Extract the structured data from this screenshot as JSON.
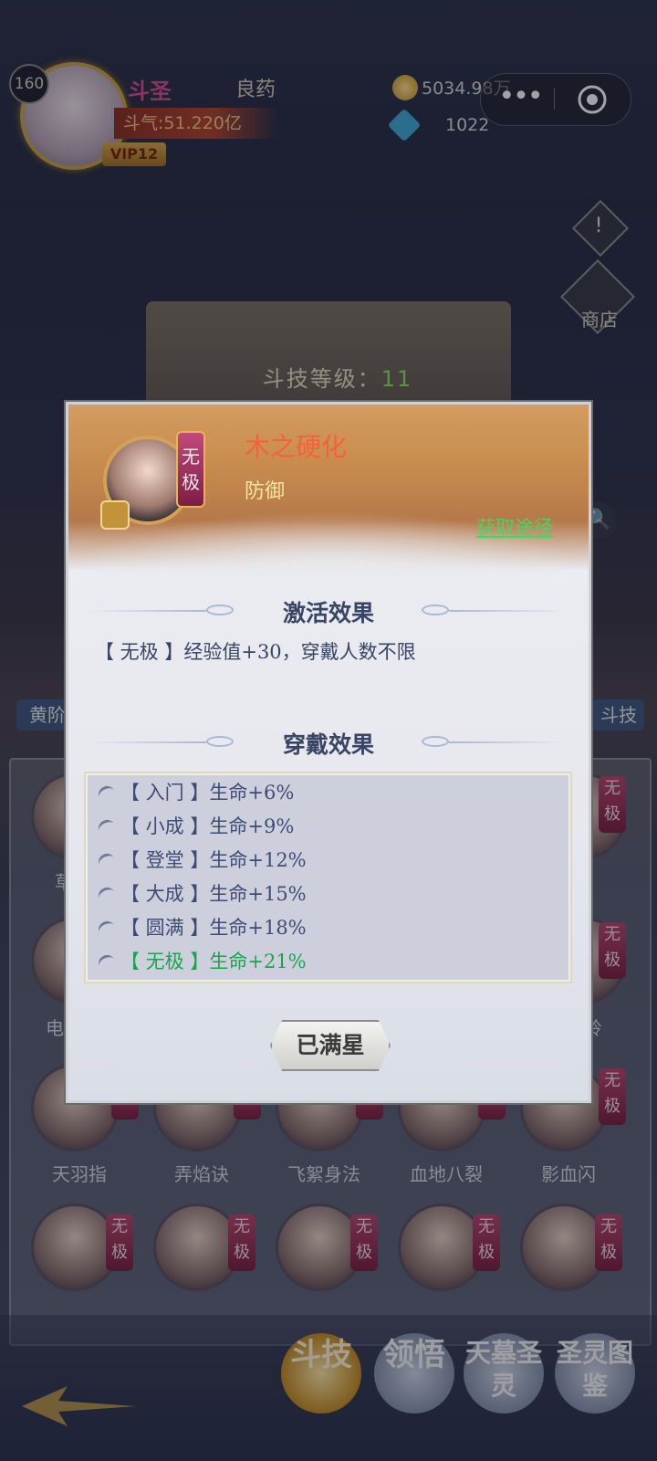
{
  "player": {
    "level": "160",
    "rank": "斗圣",
    "name": "良药",
    "power": "斗气:51.220亿",
    "vip": "VIP12"
  },
  "resources": {
    "gold": "5034.98万",
    "gems": "1022"
  },
  "side": {
    "alert": "!",
    "shop": "商店",
    "search": "🔍"
  },
  "background": {
    "level_label": "斗技等级：",
    "level_value": "11",
    "tab_left": "黄阶",
    "tab_right": "斗技"
  },
  "grid": {
    "row1": [
      {
        "name": "草",
        "tag": "无极"
      },
      {
        "name": "丧",
        "tag": "无极"
      }
    ],
    "row2": [
      {
        "name": "电",
        "tag": "无极"
      },
      {
        "name": "岭",
        "tag": "无极"
      }
    ],
    "row3": [
      {
        "name": "天羽指",
        "tag": "极"
      },
      {
        "name": "弄焰诀",
        "tag": "极"
      },
      {
        "name": "飞絮身法",
        "tag": "极"
      },
      {
        "name": "血地八裂",
        "tag": "极"
      },
      {
        "name": "影血闪",
        "tag": "无极"
      }
    ],
    "row4": [
      {
        "tag": "无极"
      },
      {
        "tag": "无极"
      },
      {
        "tag": "无极"
      },
      {
        "tag": "无极"
      },
      {
        "tag": "无极"
      }
    ]
  },
  "nav": {
    "douji": "斗技",
    "lingwu": "领悟",
    "tianmu": "天墓圣灵",
    "tujian": "圣灵图鉴"
  },
  "modal": {
    "hero_rank_tag": "无极",
    "skill_name": "木之硬化",
    "skill_type": "防御",
    "source_link": "获取途径",
    "activate_title": "激活效果",
    "activate_effect": "【 无极 】经验值+30，穿戴人数不限",
    "wear_title": "穿戴效果",
    "wear_effects": [
      {
        "tier": "【 入门 】",
        "effect": "生命+6%"
      },
      {
        "tier": "【 小成 】",
        "effect": "生命+9%"
      },
      {
        "tier": "【 登堂 】",
        "effect": "生命+12%"
      },
      {
        "tier": "【 大成 】",
        "effect": "生命+15%"
      },
      {
        "tier": "【 圆满 】",
        "effect": "生命+18%"
      },
      {
        "tier": "【 无极 】",
        "effect": "生命+21%"
      }
    ],
    "star_button": "已满星"
  },
  "colors": {
    "skill_name": "#f4623a",
    "skill_type": "#f5e6a0",
    "source_link": "#45d860",
    "active_effect": "#1ba44e",
    "title_text": "#394564"
  }
}
